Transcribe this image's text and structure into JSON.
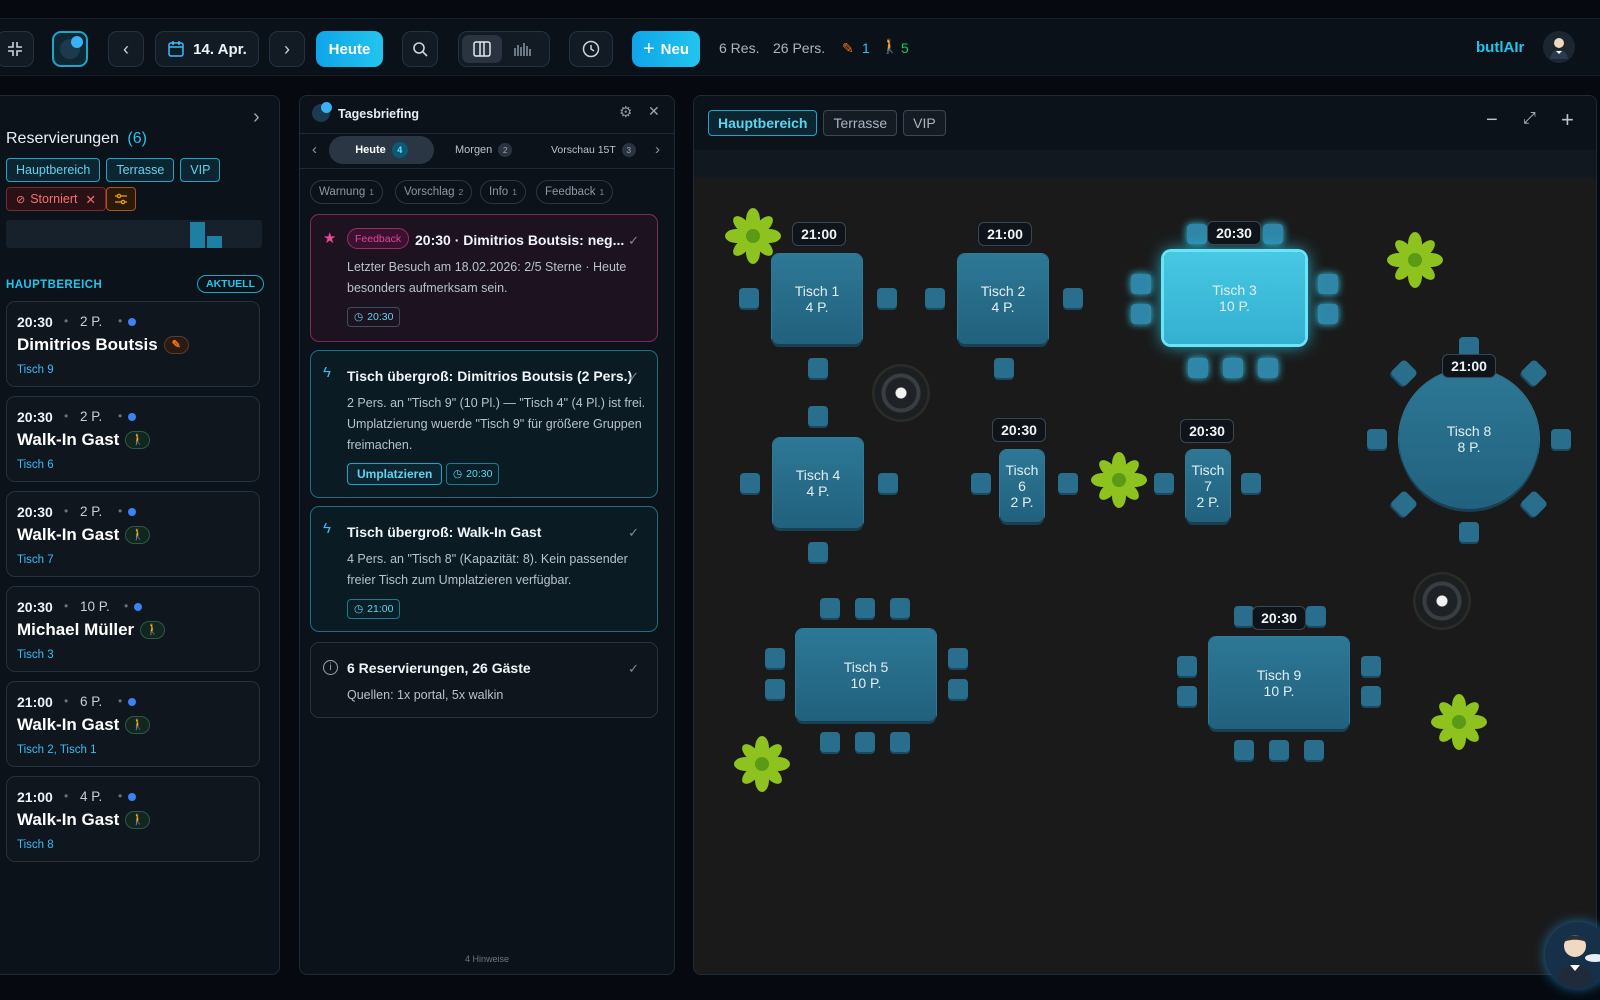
{
  "topbar": {
    "date": "14. Apr.",
    "today_label": "Heute",
    "new_label": "Neu",
    "res_count": "6 Res.",
    "pers_count": "26 Pers.",
    "edit_count": "1",
    "walkin_count": "5",
    "brand": "butlAIr"
  },
  "reservations": {
    "title": "Reservierungen",
    "count": "(6)",
    "filters": [
      "Hauptbereich",
      "Terrasse",
      "VIP"
    ],
    "cancel_chip": "Storniert",
    "section_label": "HAUPTBEREICH",
    "current_label": "AKTUELL",
    "sep": "•",
    "items": [
      {
        "time": "20:30",
        "pers": "2 P.",
        "name": "Dimitrios Boutsis",
        "table": "Tisch 9"
      },
      {
        "time": "20:30",
        "pers": "2 P.",
        "name": "Walk-In Gast",
        "table": "Tisch 6"
      },
      {
        "time": "20:30",
        "pers": "2 P.",
        "name": "Walk-In Gast",
        "table": "Tisch 7"
      },
      {
        "time": "20:30",
        "pers": "10 P.",
        "name": "Michael Müller",
        "table": "Tisch 3"
      },
      {
        "time": "21:00",
        "pers": "6 P.",
        "name": "Walk-In Gast",
        "table": "Tisch 2, Tisch 1"
      },
      {
        "time": "21:00",
        "pers": "4 P.",
        "name": "Walk-In Gast",
        "table": "Tisch 8"
      }
    ]
  },
  "briefing": {
    "title": "Tagesbriefing",
    "tabs": [
      {
        "label": "Heute",
        "count": "4"
      },
      {
        "label": "Morgen",
        "count": "2"
      },
      {
        "label": "Vorschau 15T",
        "count": "3"
      }
    ],
    "subtabs": [
      {
        "label": "Warnung",
        "count": "1"
      },
      {
        "label": "Vorschlag",
        "count": "2"
      },
      {
        "label": "Info",
        "count": "1"
      },
      {
        "label": "Feedback",
        "count": "1"
      }
    ],
    "cards": [
      {
        "tag": "Feedback",
        "title": "20:30 · Dimitrios Boutsis: neg...",
        "text": "Letzter Besuch am 18.02.2026: 2/5 Sterne · Heute besonders aufmerksam sein.",
        "time": "20:30"
      },
      {
        "title": "Tisch übergroß: Dimitrios Boutsis (2 Pers.)",
        "text": "2 Pers. an \"Tisch 9\" (10 Pl.) — \"Tisch 4\" (4 Pl.) ist frei. Umplatzierung wuerde \"Tisch 9\" für größere Gruppen freimachen.",
        "action": "Umplatzieren",
        "time": "20:30"
      },
      {
        "title": "Tisch übergroß: Walk-In Gast",
        "text": "4 Pers. an \"Tisch 8\" (Kapazität: 8). Kein passender freier Tisch zum Umplatzieren verfügbar.",
        "time": "21:00"
      },
      {
        "title": "6 Reservierungen, 26 Gäste",
        "text": "Quellen: 1x portal, 5x walkin"
      }
    ],
    "footer": "4 Hinweise"
  },
  "floor": {
    "areas": [
      "Hauptbereich",
      "Terrasse",
      "VIP"
    ],
    "tables": [
      {
        "name": "Tisch 1",
        "cap": "4 P.",
        "time": "21:00"
      },
      {
        "name": "Tisch 2",
        "cap": "4 P.",
        "time": "21:00"
      },
      {
        "name": "Tisch 3",
        "cap": "10 P.",
        "time": "20:30"
      },
      {
        "name": "Tisch 4",
        "cap": "4 P.",
        "time": ""
      },
      {
        "name": "Tisch 5",
        "cap": "10 P.",
        "time": ""
      },
      {
        "name": "Tisch 6",
        "cap": "2 P.",
        "time": "20:30"
      },
      {
        "name": "Tisch 7",
        "cap": "2 P.",
        "time": "20:30"
      },
      {
        "name": "Tisch 8",
        "cap": "8 P.",
        "time": "21:00"
      },
      {
        "name": "Tisch 9",
        "cap": "10 P.",
        "time": "20:30"
      }
    ]
  },
  "colors": {
    "accent": "#22c5ee",
    "feedback": "#ec4899",
    "selected": "#4fd8f2"
  }
}
